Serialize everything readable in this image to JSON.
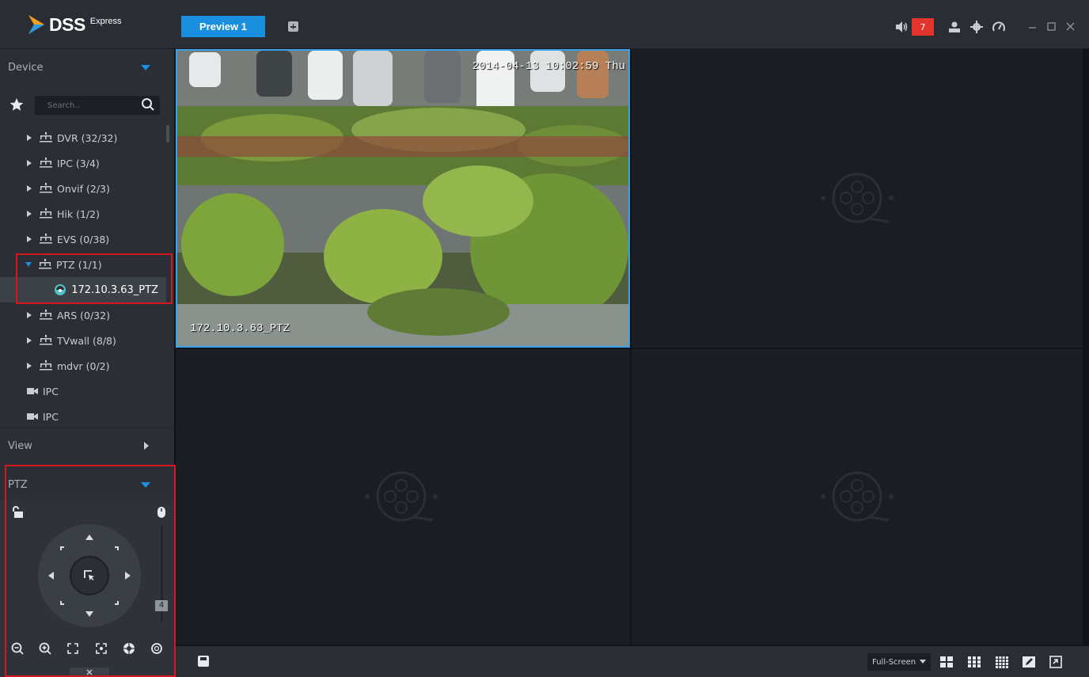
{
  "app": {
    "brand": "DSS",
    "brand_sub": "Express"
  },
  "tabs": [
    {
      "label": "Preview 1",
      "active": true
    }
  ],
  "header": {
    "alarm_count": "7"
  },
  "sidebar": {
    "device_panel": {
      "title": "Device",
      "search_placeholder": "Search.."
    },
    "tree": [
      {
        "label": "DVR (32/32)",
        "type": "group",
        "expanded": false
      },
      {
        "label": "IPC (3/4)",
        "type": "group",
        "expanded": false
      },
      {
        "label": "Onvif (2/3)",
        "type": "group",
        "expanded": false
      },
      {
        "label": "Hik (1/2)",
        "type": "group",
        "expanded": false
      },
      {
        "label": "EVS (0/38)",
        "type": "group",
        "expanded": false
      },
      {
        "label": "PTZ (1/1)",
        "type": "group",
        "expanded": true
      },
      {
        "label": "172.10.3.63_PTZ",
        "type": "device",
        "selected": true
      },
      {
        "label": "ARS (0/32)",
        "type": "group",
        "expanded": false
      },
      {
        "label": "TVwall (8/8)",
        "type": "group",
        "expanded": false
      },
      {
        "label": "mdvr (0/2)",
        "type": "group",
        "expanded": false
      },
      {
        "label": "IPC",
        "type": "camera"
      },
      {
        "label": "IPC",
        "type": "camera"
      }
    ],
    "view_panel": {
      "title": "View"
    },
    "ptz_panel": {
      "title": "PTZ",
      "speed": "4",
      "speed_level": 0.1
    }
  },
  "video": {
    "active_cell": {
      "timestamp": "2014-04-13 10:02:59 Thu",
      "channel_name": "172.10.3.63_PTZ"
    }
  },
  "bottombar": {
    "fullscreen_label": "Full-Screen"
  },
  "colors": {
    "accent": "#1a8fe0",
    "highlight": "#d4181e",
    "alarm": "#e2342d"
  }
}
